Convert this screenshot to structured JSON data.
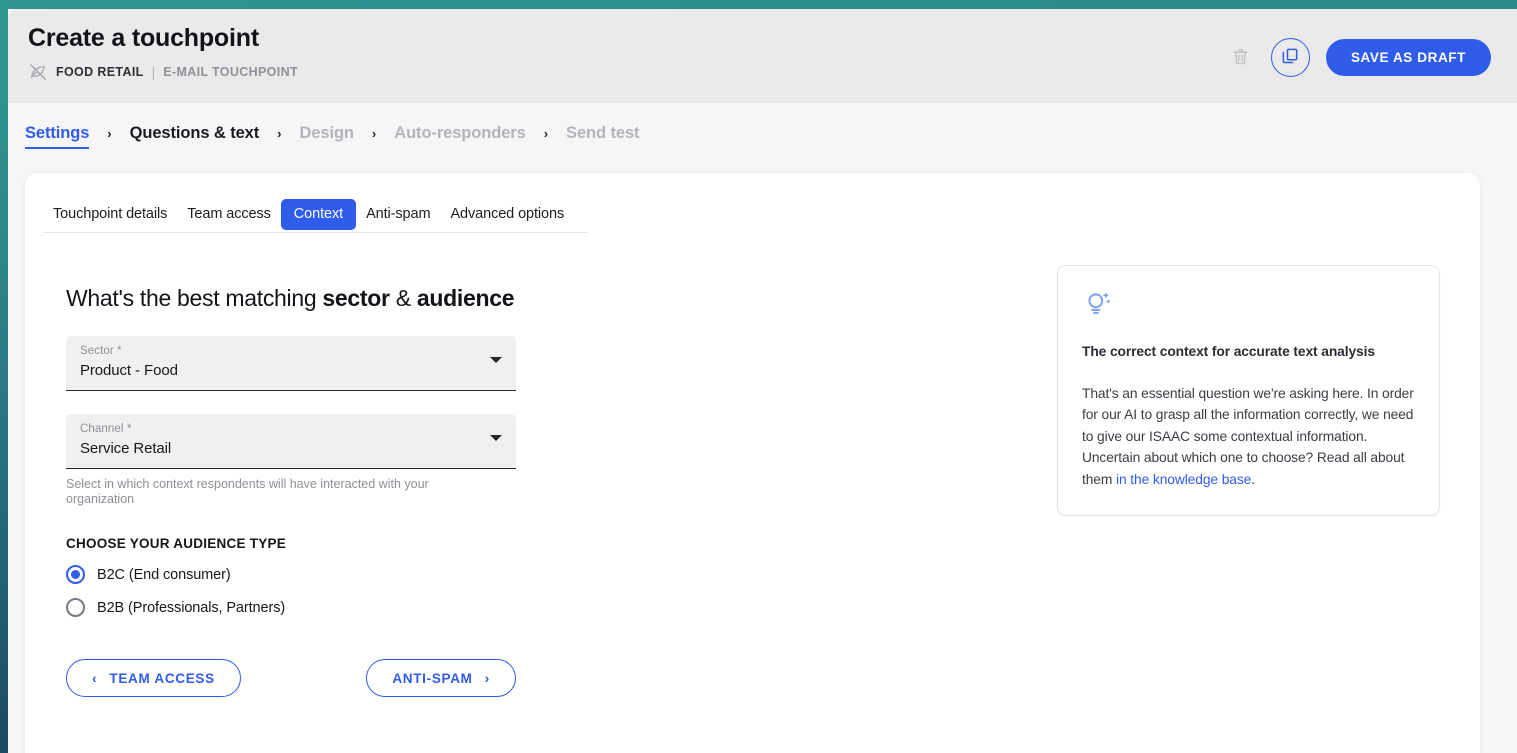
{
  "theme": {
    "accent": "#2f5ceb",
    "rail_top": "#309791",
    "rail_bottom": "#1b4a5e",
    "header_bg": "#eaeaea",
    "page_bg": "#f6f6f6"
  },
  "header": {
    "title": "Create a touchpoint",
    "brand": "FOOD RETAIL",
    "separator": "|",
    "type": "E-MAIL TOUCHPOINT",
    "leaf_icon": "leaf-disabled-icon",
    "trash_icon": "trash-icon",
    "duplicate_icon": "duplicate-icon",
    "save_label": "SAVE AS DRAFT"
  },
  "steps": [
    {
      "label": "Settings",
      "state": "active"
    },
    {
      "label": "Questions & text",
      "state": "done"
    },
    {
      "label": "Design",
      "state": "todo"
    },
    {
      "label": "Auto-responders",
      "state": "todo"
    },
    {
      "label": "Send test",
      "state": "todo"
    }
  ],
  "step_chevron": "›",
  "tabs": [
    {
      "label": "Touchpoint details",
      "selected": false
    },
    {
      "label": "Team access",
      "selected": false
    },
    {
      "label": "Context",
      "selected": true
    },
    {
      "label": "Anti-spam",
      "selected": false
    },
    {
      "label": "Advanced options",
      "selected": false
    }
  ],
  "form": {
    "heading_plain_1": "What's the best matching ",
    "heading_bold_1": "sector",
    "heading_plain_2": " & ",
    "heading_bold_2": "audience",
    "sector": {
      "label": "Sector *",
      "value": "Product - Food"
    },
    "channel": {
      "label": "Channel *",
      "value": "Service Retail",
      "help": "Select in which context respondents will have interacted with your organization"
    },
    "audience_title": "CHOOSE YOUR AUDIENCE TYPE",
    "audience_options": [
      {
        "label": "B2C (End consumer)",
        "checked": true
      },
      {
        "label": "B2B (Professionals, Partners)",
        "checked": false
      }
    ],
    "prev_button": "TEAM ACCESS",
    "next_button": "ANTI-SPAM",
    "prev_arrow": "‹",
    "next_arrow": "›"
  },
  "info_card": {
    "icon": "lightbulb-idea-icon",
    "title": "The correct context for accurate text analysis",
    "body_before": "That's an essential question we're asking here. In order for our AI to grasp all the information correctly, we need to give our ISAAC some contextual information. Uncertain about which one to choose? Read all about them ",
    "link_text": "in the knowledge base",
    "body_after": "."
  }
}
